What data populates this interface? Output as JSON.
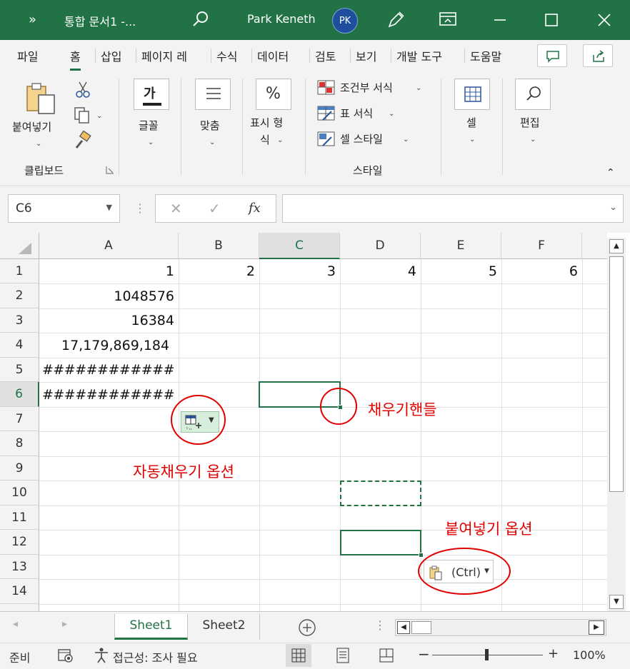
{
  "title_bar": {
    "more": "»",
    "doc_title": "통합 문서1  -...",
    "user": "Park Keneth",
    "avatar": "PK"
  },
  "tabs": [
    "파일",
    "홈",
    "삽입",
    "페이지 레",
    "수식",
    "데이터",
    "검토",
    "보기",
    "개발 도구",
    "도움말"
  ],
  "ribbon": {
    "paste": "붙여넣기",
    "clipboard": "클립보드",
    "font": "글꼴",
    "font_icon": "가",
    "align": "맞춤",
    "number_line1": "표시 형",
    "number_line2": "식",
    "percent": "%",
    "conditional": "조건부 서식",
    "table_format": "표 서식",
    "cell_style": "셀 스타일",
    "styles": "스타일",
    "cells": "셀",
    "edit": "편집"
  },
  "formula_bar": {
    "name_box": "C6",
    "fx": "fx",
    "formula": ""
  },
  "columns": [
    "A",
    "B",
    "C",
    "D",
    "E",
    "F"
  ],
  "rows": [
    "1",
    "2",
    "3",
    "4",
    "5",
    "6",
    "7",
    "8",
    "9",
    "10",
    "11",
    "12",
    "13",
    "14"
  ],
  "cells": {
    "A1": "1",
    "B1": "2",
    "C1": "3",
    "D1": "4",
    "E1": "5",
    "F1": "6",
    "A2": "1048576",
    "A3": "16384",
    "A4": "17,179,869,184",
    "A5": "############",
    "A6": "############"
  },
  "annotations": {
    "fill_handle": "채우기핸들",
    "autofill_options": "자동채우기 옵션",
    "paste_options": "붙여넣기 옵션",
    "ctrl": "(Ctrl)"
  },
  "sheets": [
    "Sheet1",
    "Sheet2"
  ],
  "status": {
    "ready": "준비",
    "accessibility": "접근성: 조사 필요",
    "zoom": "100%"
  },
  "colors": {
    "accent": "#217346",
    "annotation": "#e00000"
  }
}
